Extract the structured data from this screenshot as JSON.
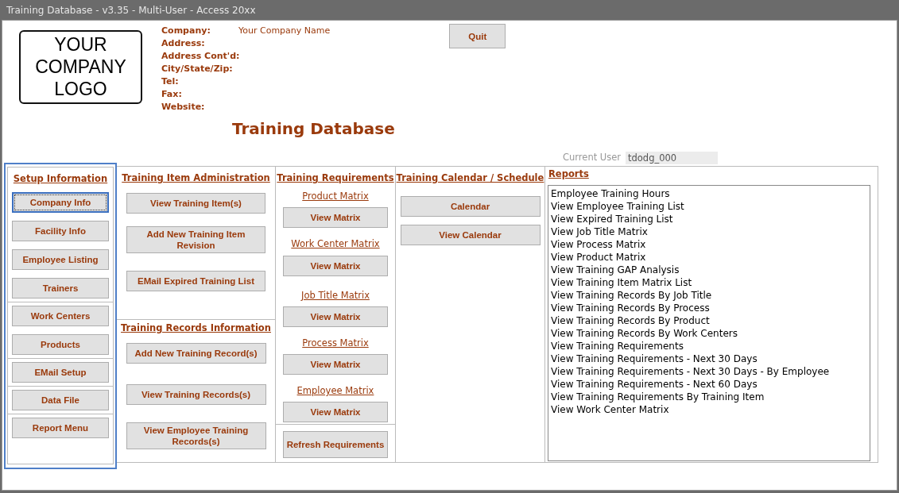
{
  "window": {
    "title": "Training Database - v3.35 - Multi-User - Access 20xx"
  },
  "logo": {
    "text": "YOUR COMPANY LOGO"
  },
  "company_fields": [
    {
      "label": "Company:",
      "value": "Your Company Name"
    },
    {
      "label": "Address:"
    },
    {
      "label": "Address Cont'd:"
    },
    {
      "label": "City/State/Zip:"
    },
    {
      "label": "Tel:"
    },
    {
      "label": "Fax:"
    },
    {
      "label": "Website:"
    }
  ],
  "quit_button": "Quit",
  "heading": "Training Database",
  "current_user": {
    "label": "Current User",
    "value": "tdodg_000"
  },
  "setup": {
    "title": "Setup Information",
    "highlighted": true,
    "groups": [
      {
        "buttons": [
          {
            "label": "Company Info",
            "focused": true
          },
          {
            "label": "Facility Info",
            "focused": false
          },
          {
            "label": "Employee Listing",
            "focused": false
          },
          {
            "label": "Trainers",
            "focused": false
          }
        ]
      },
      {
        "buttons": [
          {
            "label": "Work Centers",
            "focused": false
          },
          {
            "label": "Products",
            "focused": false
          }
        ]
      },
      {
        "buttons": [
          {
            "label": "EMail Setup",
            "focused": false
          }
        ]
      },
      {
        "buttons": [
          {
            "label": "Data File",
            "focused": false
          }
        ]
      },
      {
        "buttons": [
          {
            "label": "Report Menu",
            "focused": false
          }
        ]
      }
    ]
  },
  "item_admin": {
    "title": "Training Item Administration",
    "buttons": [
      "View Training Item(s)",
      "Add New Training Item Revision",
      "EMail Expired Training List"
    ]
  },
  "records": {
    "title": "Training Records Information",
    "buttons": [
      "Add New Training Record(s)",
      "View Training Records(s)",
      "View Employee Training Records(s)"
    ]
  },
  "requirements": {
    "title": "Training Requirements",
    "matrices": [
      {
        "link": "Product Matrix",
        "button": "View Matrix"
      },
      {
        "link": "Work Center Matrix",
        "button": "View Matrix"
      },
      {
        "link": "Job Title Matrix",
        "button": "View Matrix"
      },
      {
        "link": "Process Matrix",
        "button": "View Matrix"
      },
      {
        "link": "Employee Matrix",
        "button": "View Matrix"
      }
    ],
    "refresh_button": "Refresh Requirements"
  },
  "calendar": {
    "title": "Training Calendar / Schedule",
    "buttons": [
      "Calendar",
      "View Calendar"
    ]
  },
  "reports": {
    "title": "Reports",
    "items": [
      "Employee Training Hours",
      "View Employee Training List",
      "View Expired Training List",
      "View Job Title Matrix",
      "View Process Matrix",
      "View Product Matrix",
      "View Training GAP Analysis",
      "View Training Item Matrix List",
      "View Training Records By Job Title",
      "View Training Records By Process",
      "View Training Records By Product",
      "View Training Records By Work Centers",
      "View Training Requirements",
      "View Training Requirements - Next 30 Days",
      "View Training Requirements - Next 30 Days - By Employee",
      "View Training Requirements - Next 60 Days",
      "View Training Requirements By Training Item",
      "View Work Center Matrix"
    ]
  }
}
